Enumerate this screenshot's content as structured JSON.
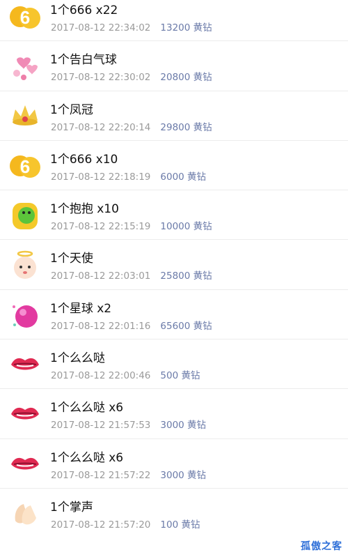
{
  "gifts": [
    {
      "icon": "six-six-six-icon",
      "title": "1个666 x22",
      "time": "2017-08-12 22:34:02",
      "price": "13200 黄钻"
    },
    {
      "icon": "love-balloon-icon",
      "title": "1个告白气球",
      "time": "2017-08-12 22:30:02",
      "price": "20800 黄钻"
    },
    {
      "icon": "crown-icon",
      "title": "1个凤冠",
      "time": "2017-08-12 22:20:14",
      "price": "29800 黄钻"
    },
    {
      "icon": "six-six-six-icon",
      "title": "1个666 x10",
      "time": "2017-08-12 22:18:19",
      "price": "6000 黄钻"
    },
    {
      "icon": "hug-icon",
      "title": "1个抱抱 x10",
      "time": "2017-08-12 22:15:19",
      "price": "10000 黄钻"
    },
    {
      "icon": "angel-icon",
      "title": "1个天使",
      "time": "2017-08-12 22:03:01",
      "price": "25800 黄钻"
    },
    {
      "icon": "planet-icon",
      "title": "1个星球 x2",
      "time": "2017-08-12 22:01:16",
      "price": "65600 黄钻"
    },
    {
      "icon": "lips-icon",
      "title": "1个么么哒",
      "time": "2017-08-12 22:00:46",
      "price": "500 黄钻"
    },
    {
      "icon": "lips-icon",
      "title": "1个么么哒 x6",
      "time": "2017-08-12 21:57:53",
      "price": "3000 黄钻"
    },
    {
      "icon": "lips-icon",
      "title": "1个么么哒 x6",
      "time": "2017-08-12 21:57:22",
      "price": "3000 黄钻"
    },
    {
      "icon": "clap-icon",
      "title": "1个掌声",
      "time": "2017-08-12 21:57:20",
      "price": "100 黄钻"
    }
  ],
  "watermark": "孤傲之客"
}
